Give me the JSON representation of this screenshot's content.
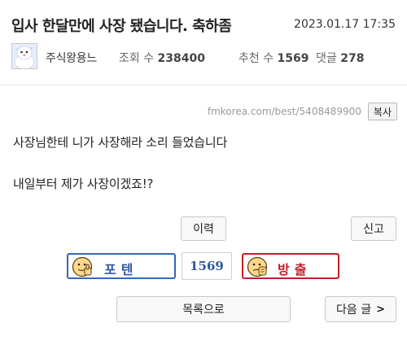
{
  "post": {
    "title": "입사 한달만에 사장 됐습니다. 축하좀",
    "date": "2023.01.17 17:35",
    "author": "주식왕용느",
    "views_label": "조회 수",
    "views": "238400",
    "votes_label": "추천 수",
    "votes": "1569",
    "comments_label": "댓글",
    "comments": "278",
    "url": "fmkorea.com/best/5408489900",
    "copy_label": "복사",
    "body": [
      "사장님한테 니가 사장해라 소리 들었습니다",
      "내일부터 제가 사장이겠죠!?"
    ]
  },
  "actions": {
    "history_label": "이력",
    "report_label": "신고",
    "upvote_label": "포텐",
    "vote_count": "1569",
    "downvote_label": "방출",
    "list_label": "목록으로",
    "next_label": "다음 글",
    "next_arrow": ">"
  },
  "colors": {
    "upvote": "#3567b7",
    "downvote": "#c41e28",
    "count": "#2f58a3"
  },
  "icons": {
    "avatar": "snowman-avatar-icon",
    "upvote": "face-thumb-icon",
    "downvote": "face-hand-icon"
  }
}
